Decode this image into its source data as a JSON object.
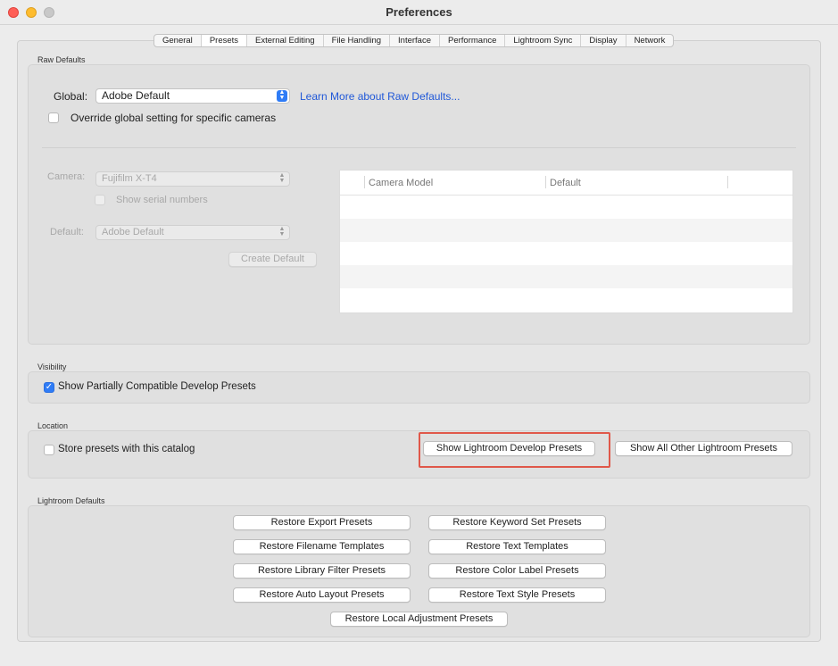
{
  "window": {
    "title": "Preferences"
  },
  "tabs": [
    {
      "label": "General"
    },
    {
      "label": "Presets",
      "active": true
    },
    {
      "label": "External Editing"
    },
    {
      "label": "File Handling"
    },
    {
      "label": "Interface"
    },
    {
      "label": "Performance"
    },
    {
      "label": "Lightroom Sync"
    },
    {
      "label": "Display"
    },
    {
      "label": "Network"
    }
  ],
  "raw_defaults": {
    "section_label": "Raw Defaults",
    "global_label": "Global:",
    "global_value": "Adobe Default",
    "learn_more_link": "Learn More about Raw Defaults...",
    "override_label": "Override global setting for specific cameras",
    "override_checked": false,
    "camera_label": "Camera:",
    "camera_value": "Fujifilm X-T4",
    "show_serial_label": "Show serial numbers",
    "default_label": "Default:",
    "default_value": "Adobe Default",
    "create_default_button": "Create Default",
    "table": {
      "columns": [
        "Camera Model",
        "Default"
      ],
      "rows": []
    }
  },
  "visibility": {
    "section_label": "Visibility",
    "show_partial_label": "Show Partially Compatible Develop Presets",
    "show_partial_checked": true
  },
  "location": {
    "section_label": "Location",
    "store_presets_label": "Store presets with this catalog",
    "store_presets_checked": false,
    "show_develop_button": "Show Lightroom Develop Presets",
    "show_other_button": "Show All Other Lightroom Presets"
  },
  "lightroom_defaults": {
    "section_label": "Lightroom Defaults",
    "buttons": {
      "export": "Restore Export Presets",
      "keyword_set": "Restore Keyword Set Presets",
      "filename": "Restore Filename Templates",
      "text_templates": "Restore Text Templates",
      "library_filter": "Restore Library Filter Presets",
      "color_label": "Restore Color Label Presets",
      "auto_layout": "Restore Auto Layout Presets",
      "text_style": "Restore Text Style Presets",
      "local_adjustment": "Restore Local Adjustment Presets"
    }
  },
  "colors": {
    "accent": "#2f7cf6",
    "link": "#2058d8",
    "highlight": "#e0584a"
  }
}
